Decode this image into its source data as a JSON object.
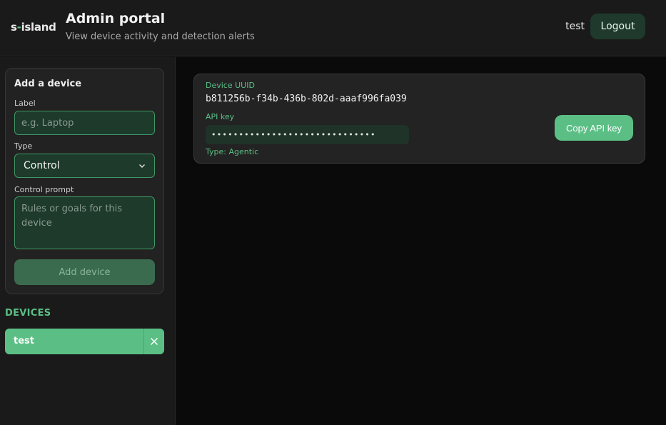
{
  "header": {
    "logo_prefix": "s",
    "logo_dash": "-",
    "logo_suffix": "island",
    "title": "Admin portal",
    "subtitle": "View device activity and detection alerts",
    "username": "test",
    "logout_label": "Logout"
  },
  "add_device": {
    "title": "Add a device",
    "label_field_label": "Label",
    "label_placeholder": "e.g. Laptop",
    "type_field_label": "Type",
    "type_selected": "Control",
    "prompt_field_label": "Control prompt",
    "prompt_placeholder": "Rules or goals for this device",
    "submit_label": "Add device"
  },
  "devices": {
    "heading": "DEVICES",
    "items": [
      {
        "name": "test"
      }
    ]
  },
  "device_detail": {
    "uuid_label": "Device UUID",
    "uuid": "b811256b-f34b-436b-802d-aaaf996fa039",
    "api_key_label": "API key",
    "api_key_masked": "••••••••••••••••••••••••••••••",
    "type_text": "Type: Agentic",
    "copy_label": "Copy API key"
  },
  "colors": {
    "accent": "#5bbf85",
    "background": "#0a0a0a",
    "panel": "#1a1a1a"
  }
}
